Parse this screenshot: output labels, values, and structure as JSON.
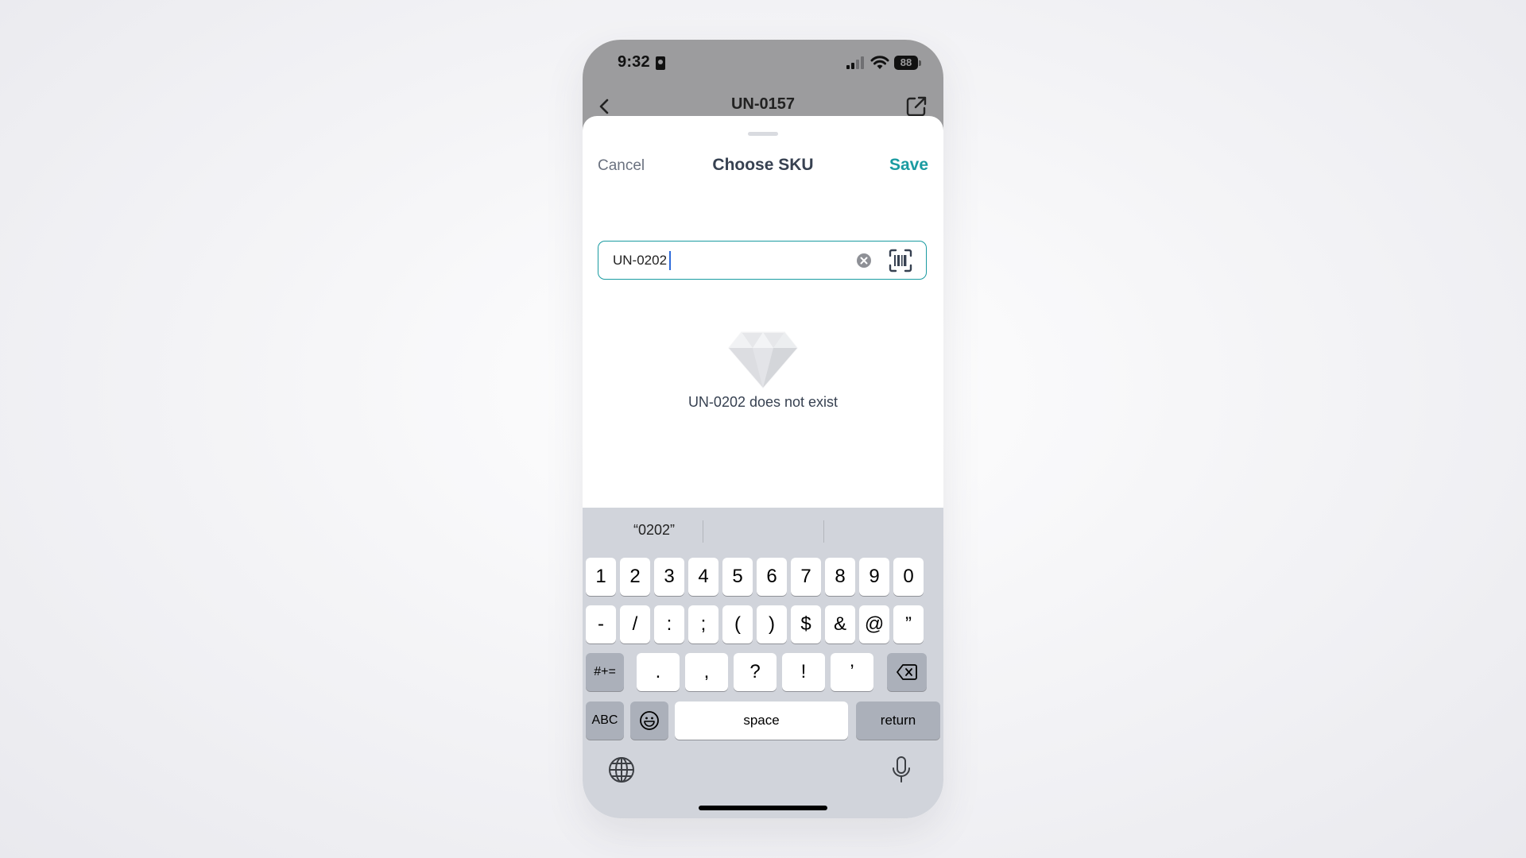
{
  "status_bar": {
    "time": "9:32",
    "battery": "88"
  },
  "background_nav": {
    "title": "UN-0157",
    "back_icon": "chevron-left-icon",
    "share_icon": "share-icon"
  },
  "sheet": {
    "cancel_label": "Cancel",
    "title": "Choose SKU",
    "save_label": "Save"
  },
  "search": {
    "value": "UN-0202",
    "clear_icon": "clear-icon",
    "scan_icon": "barcode-scan-icon"
  },
  "empty_state": {
    "icon": "diamond-icon",
    "message": "UN-0202 does not exist"
  },
  "keyboard": {
    "suggestions": [
      "“0202”",
      "",
      ""
    ],
    "row1": [
      "1",
      "2",
      "3",
      "4",
      "5",
      "6",
      "7",
      "8",
      "9",
      "0"
    ],
    "row2": [
      "-",
      "/",
      ":",
      ";",
      "(",
      ")",
      "$",
      "&",
      "@",
      "”"
    ],
    "row3": [
      ".",
      ",",
      "?",
      "!",
      "’"
    ],
    "symbols_key": "#+=",
    "abc_key": "ABC",
    "space_key": "space",
    "return_key": "return"
  },
  "colors": {
    "accent": "#1a9ba1",
    "keyboard_bg": "#d1d4db",
    "dim_overlay": "#9c9c9e"
  }
}
